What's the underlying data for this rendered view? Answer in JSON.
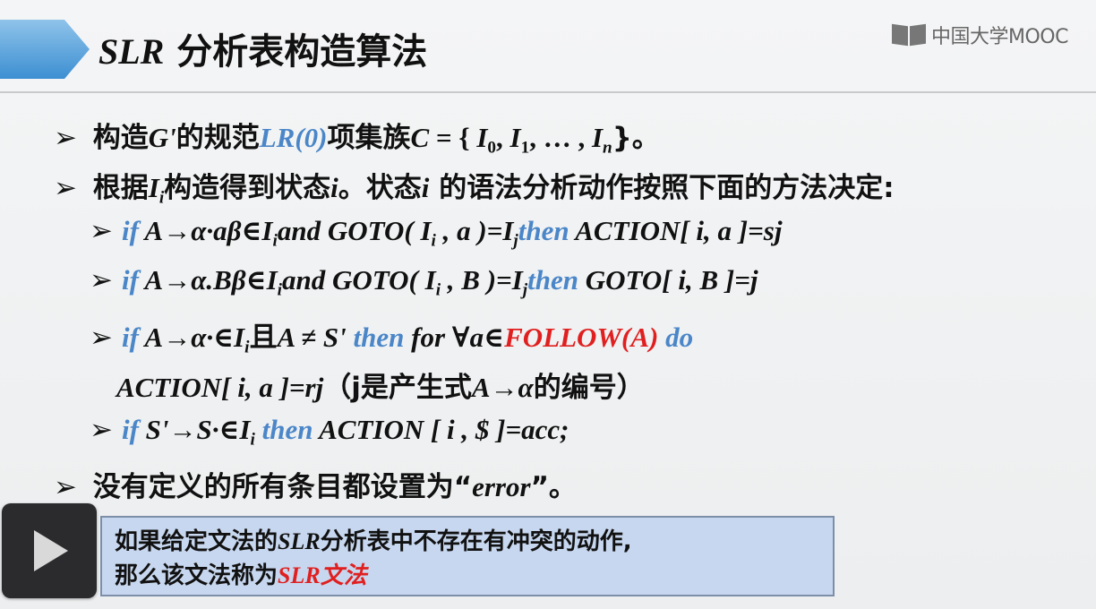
{
  "header": {
    "title_latin": "SLR",
    "title_cjk": "分析表构造算法",
    "logo_text": "中国大学MOOC"
  },
  "line1": {
    "a": "构造",
    "b": "G'",
    "c": "的规范",
    "d": "LR(0)",
    "e": "项集族",
    "f": "C",
    "g": " = { ",
    "h": "I",
    "h_sub": "0",
    "i": ", ",
    "j": "I",
    "j_sub": "1",
    "k": ", … , ",
    "l": "I",
    "l_sub": "n",
    "m": "}。"
  },
  "line2": {
    "a": "根据",
    "b": "I",
    "b_sub": "i",
    "c": "构造得到状态",
    "d": "i",
    "e": "。状态",
    "f": "i",
    "g": " 的语法分析动作按照下面的方法决定:"
  },
  "line3": {
    "if": "if",
    "a": " A→α·aβ∈I",
    "a_sub": "i",
    "b": "and GOTO( I",
    "b_sub": "i",
    "c": " , a )=I",
    "c_sub": "j",
    "then": "then",
    "d": " ACTION[ i, a ]=sj"
  },
  "line4": {
    "if": "if",
    "a": " A→α.Bβ∈I",
    "a_sub": "i",
    "b": "and GOTO( I",
    "b_sub": "i",
    "c": " , B )=I",
    "c_sub": "j",
    "then": "then",
    "d": " GOTO[ i, B ]=j"
  },
  "line5": {
    "if": "if",
    "a": " A→α·∈I",
    "a_sub": "i",
    "b": "且",
    "c": "A ≠ S'",
    "then": " then",
    "d": " for ∀a∈",
    "follow": "FOLLOW(A)",
    "do": " do"
  },
  "line6": {
    "a": "ACTION[ i, a ]=rj",
    "b": "（j是产生式",
    "c": "A→α",
    "d": "的编号）"
  },
  "line7": {
    "if": "if",
    "a": " S'→S·∈I",
    "a_sub": "i",
    "then": " then",
    "b": " ACTION [ i , $ ]=acc;"
  },
  "line8": {
    "a": "没有定义的所有条目都设置为“",
    "b": "error",
    "c": "”。"
  },
  "note": {
    "row1_a": "如果给定文法的",
    "row1_b": "SLR",
    "row1_c": "分析表中不存在有冲突的动作,",
    "row2_a": "那么该文法称为",
    "row2_b": "SLR文法"
  },
  "controls": {
    "play_icon": "play-icon"
  },
  "colors": {
    "blue": "#4a86c8",
    "red": "#e02020",
    "note_bg": "#c7d7ef"
  }
}
